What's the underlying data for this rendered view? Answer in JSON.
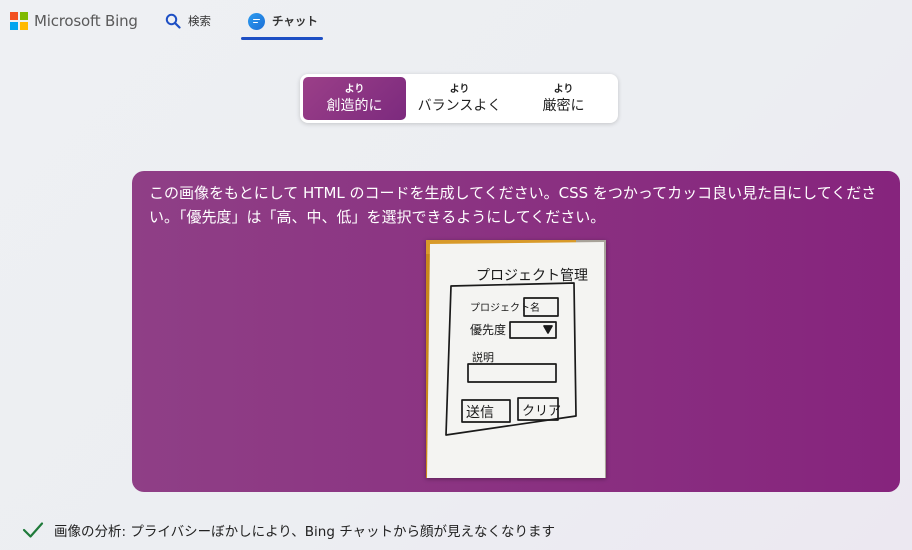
{
  "header": {
    "logo_text": "Microsoft Bing",
    "logo_colors": [
      "#f25022",
      "#7fba00",
      "#00a4ef",
      "#ffb900"
    ],
    "nav": {
      "search_label": "検索",
      "chat_label": "チャット"
    },
    "accent": "#1d4fc4"
  },
  "conversation_style": {
    "options": [
      {
        "small": "より",
        "label": "創造的に",
        "active": true
      },
      {
        "small": "より",
        "label": "バランスよく",
        "active": false
      },
      {
        "small": "より",
        "label": "厳密に",
        "active": false
      }
    ]
  },
  "user_message": {
    "text": "この画像をもとにして HTML のコードを生成してください。CSS をつかってカッコ良い見た目にしてください。「優先度」は「高、中、低」を選択できるようにしてください。",
    "bubble_color": "#8a2f80",
    "attached_image": {
      "title": "プロジェクト管理",
      "project_name_label": "プロジェクト名",
      "priority_label": "優先度",
      "description_label": "説明",
      "submit_label": "送信",
      "clear_label": "クリア"
    }
  },
  "status": {
    "icon": "checkmark-icon",
    "text": "画像の分析: プライバシーぼかしにより、Bing チャットから顔が見えなくなります"
  }
}
